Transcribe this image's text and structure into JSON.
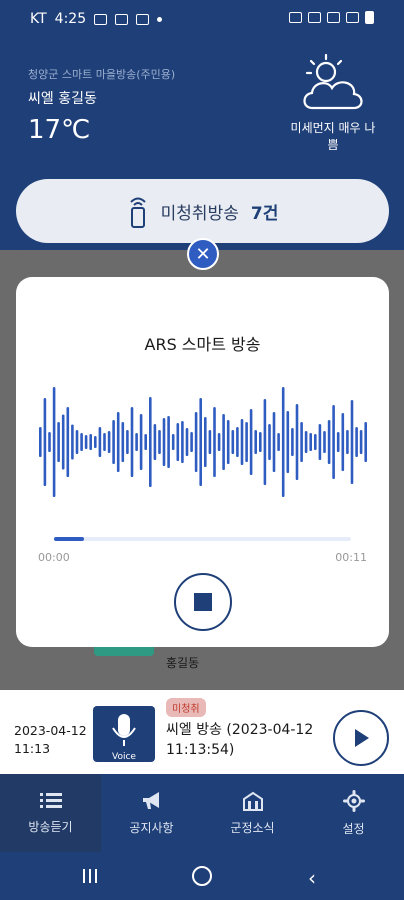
{
  "status_bar": {
    "carrier": "KT",
    "time": "4:25"
  },
  "header": {
    "village": "청양군 스마트 마을방송(주민용)",
    "location": "씨엘 홍길동",
    "temperature": "17℃",
    "weather_icon": "sun-cloud-icon",
    "dust_status": "미세먼지 매우 나쁨"
  },
  "unheard": {
    "label": "미청취방송",
    "count": "7건"
  },
  "modal": {
    "title": "ARS 스마트 방송",
    "current_time": "00:00",
    "total_time": "00:11",
    "progress": 0.1,
    "stop_icon": "stop-icon",
    "close_icon": "close-icon"
  },
  "list": {
    "prev_location": "홍길동",
    "item": {
      "badge": "미청취",
      "date": "2023-04-12",
      "time": "11:13",
      "title": "씨엘 방송 (2023-04-12 11:13:54)",
      "thumb_label": "Voice"
    }
  },
  "nav": [
    {
      "label": "방송듣기",
      "icon": "list-icon"
    },
    {
      "label": "공지사항",
      "icon": "megaphone-icon"
    },
    {
      "label": "군정소식",
      "icon": "building-icon"
    },
    {
      "label": "설정",
      "icon": "gear-icon"
    }
  ],
  "colors": {
    "navy": "#1f3f78",
    "accent": "#2f5cc1",
    "badge_red": "#c0392b"
  }
}
